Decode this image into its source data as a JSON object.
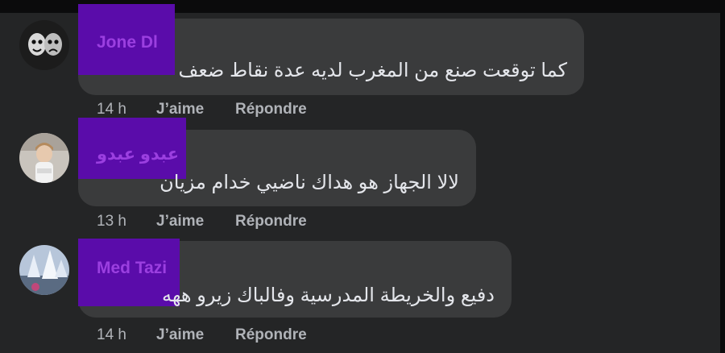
{
  "comments": [
    {
      "author": "Jone Dl",
      "text": "كما توقعت صنع من المغرب لديه عدة نقاط ضعف",
      "time": "14 h",
      "like_label": "J’aime",
      "reply_label": "Répondre"
    },
    {
      "author": "عبدو عبدو",
      "text": "لالا الجهاز هو هداك ناضيي خدام مزيان",
      "time": "13 h",
      "like_label": "J’aime",
      "reply_label": "Répondre"
    },
    {
      "author": "Med Tazi",
      "text": "دفيع والخريطة المدرسية وفالباك زيرو ههه",
      "time": "14 h",
      "like_label": "J’aime",
      "reply_label": "Répondre"
    }
  ],
  "colors": {
    "background": "#242526",
    "bubble": "#3a3b3c",
    "author_highlight": "#5a0caa",
    "author_text": "#9b3fe0",
    "comment_text": "#e4e6eb",
    "meta_text": "#b0b3b8"
  }
}
